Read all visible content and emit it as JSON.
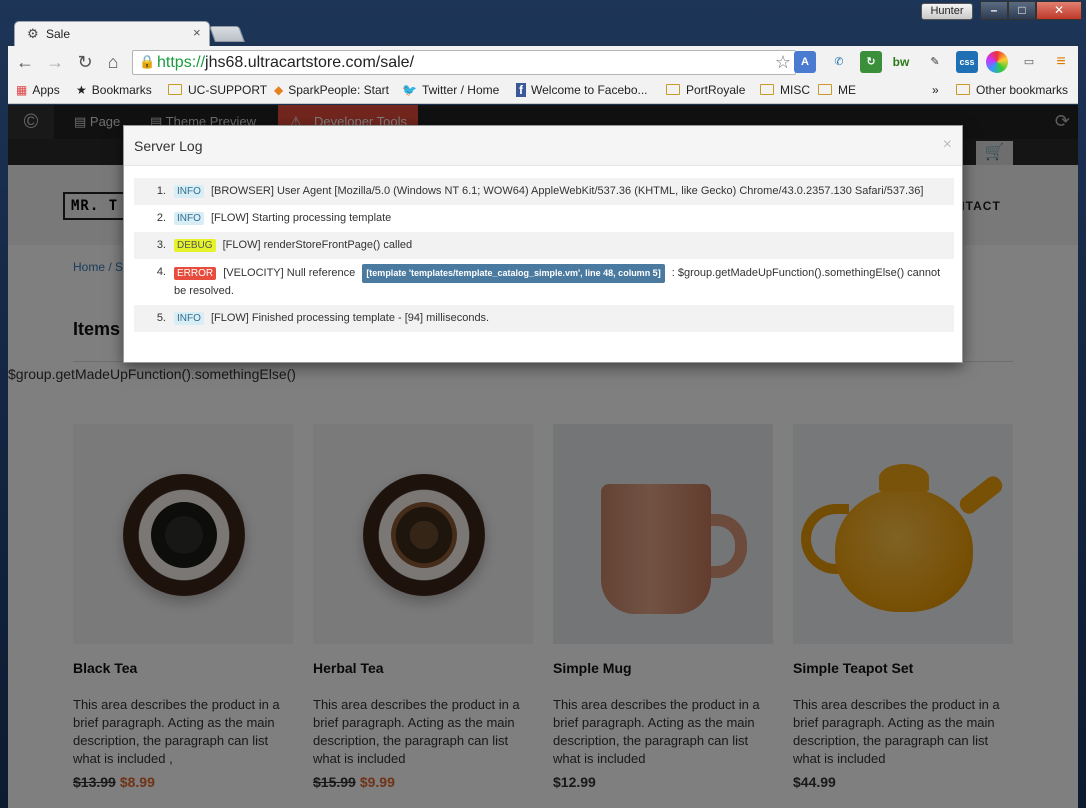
{
  "browser": {
    "tab_title": "Sale",
    "profile_name": "Hunter",
    "url_https": "https://",
    "url_rest": "jhs68.ultracartstore.com/sale/",
    "bookmarks": [
      "Apps",
      "Bookmarks",
      "UC-SUPPORT",
      "SparkPeople: Start",
      "Twitter / Home",
      "Welcome to Facebo...",
      "PortRoyale",
      "MISC",
      "ME",
      "»",
      "Other bookmarks"
    ],
    "colors": {
      "secure_green": "#1a9c3f",
      "chrome_bg": "#f2f2f2",
      "frame_blue": "#1d3557"
    }
  },
  "ucbar": {
    "page_label": "Page",
    "theme_label": "Theme Preview",
    "dev_label": "Developer Tools",
    "dev_color": "#e74c3c"
  },
  "store": {
    "logo": "MR. T",
    "nav_contact": "NTACT",
    "breadcrumb": "Home / S",
    "items_title": "Items",
    "error_text": "$group.getMadeUpFunction().somethingElse()"
  },
  "products": [
    {
      "name": "Black Tea",
      "desc": "This area describes the product in a brief paragraph. Acting as the main description, the paragraph can list what is included ,",
      "old_price": "$13.99",
      "price": "$8.99"
    },
    {
      "name": "Herbal Tea",
      "desc": "This area describes the product in a brief paragraph. Acting as the main description, the paragraph can list what is included",
      "old_price": "$15.99",
      "price": "$9.99"
    },
    {
      "name": "Simple Mug",
      "desc": "This area describes the product in a brief paragraph. Acting as the main description, the paragraph can list what is included",
      "old_price": "",
      "price": "$12.99"
    },
    {
      "name": "Simple Teapot Set",
      "desc": "This area describes the product in a brief paragraph. Acting as the main description, the paragraph can list what is included",
      "old_price": "",
      "price": "$44.99"
    }
  ],
  "modal": {
    "title": "Server Log",
    "close": "×",
    "entries": [
      {
        "num": "1.",
        "level": "INFO",
        "text": "[BROWSER] User Agent [Mozilla/5.0 (Windows NT 6.1; WOW64) AppleWebKit/537.36 (KHTML, like Gecko) Chrome/43.0.2357.130 Safari/537.36]"
      },
      {
        "num": "2.",
        "level": "INFO",
        "text": "[FLOW] Starting processing template"
      },
      {
        "num": "3.",
        "level": "DEBUG",
        "text": "[FLOW] renderStoreFrontPage() called"
      },
      {
        "num": "4.",
        "level": "ERROR",
        "text": "[VELOCITY] Null reference",
        "location": "[template 'templates/template_catalog_simple.vm', line 48, column 5]",
        "text2": ": $group.getMadeUpFunction().somethingElse() cannot be resolved."
      },
      {
        "num": "5.",
        "level": "INFO",
        "text": "[FLOW] Finished processing template - [94] milliseconds."
      }
    ]
  }
}
